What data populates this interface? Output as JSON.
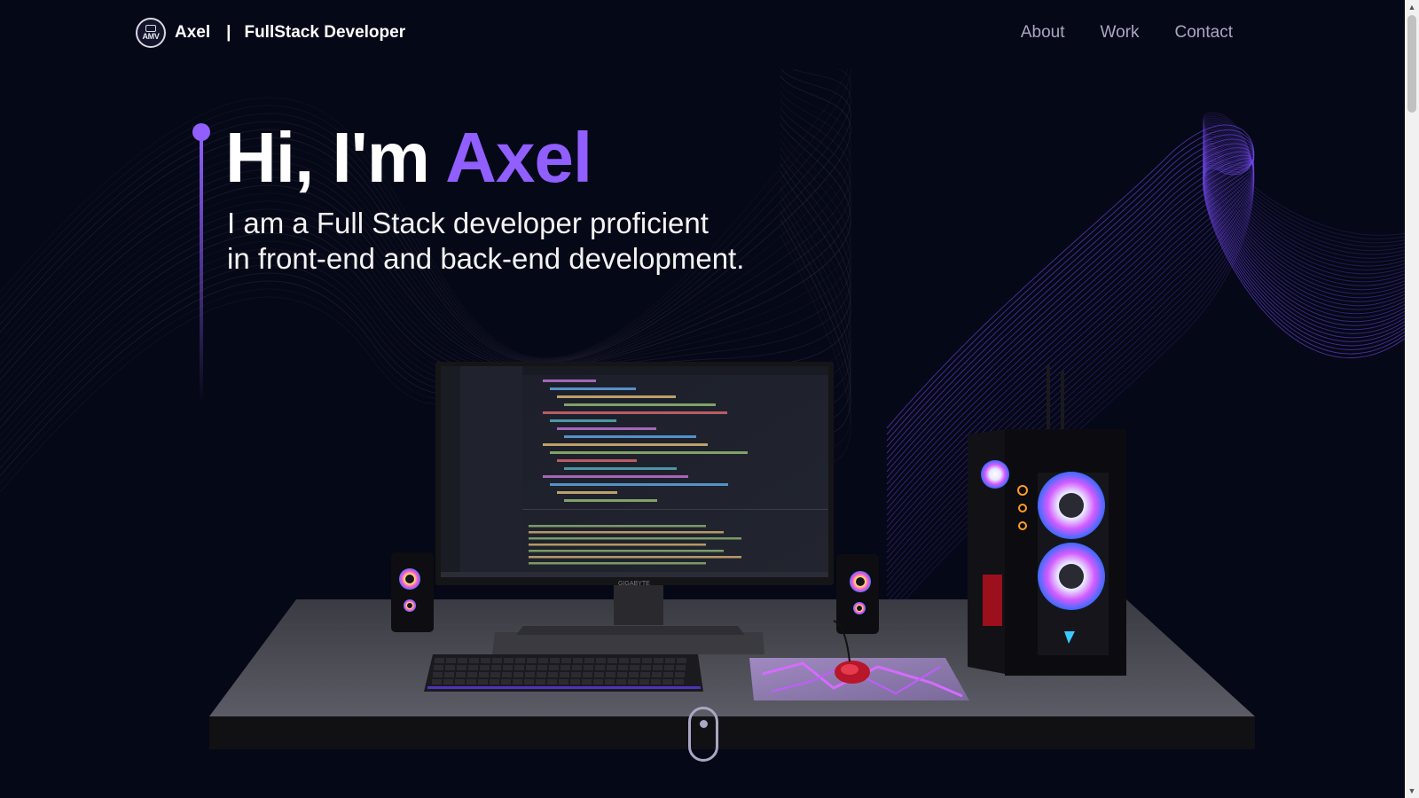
{
  "nav": {
    "logo_text": "AMV",
    "brand_name": "Axel",
    "separator": "|",
    "brand_role": "FullStack Developer",
    "links": [
      "About",
      "Work",
      "Contact"
    ]
  },
  "hero": {
    "greeting": "Hi, I'm ",
    "name": "Axel",
    "subtitle_line1": "I am a Full Stack developer proficient",
    "subtitle_line2": "in front-end and back-end development."
  },
  "scene": {
    "monitor_brand": "GIGABYTE"
  },
  "colors": {
    "background": "#050816",
    "accent": "#915eff",
    "nav_text": "#aaa6c3",
    "white": "#ffffff"
  }
}
